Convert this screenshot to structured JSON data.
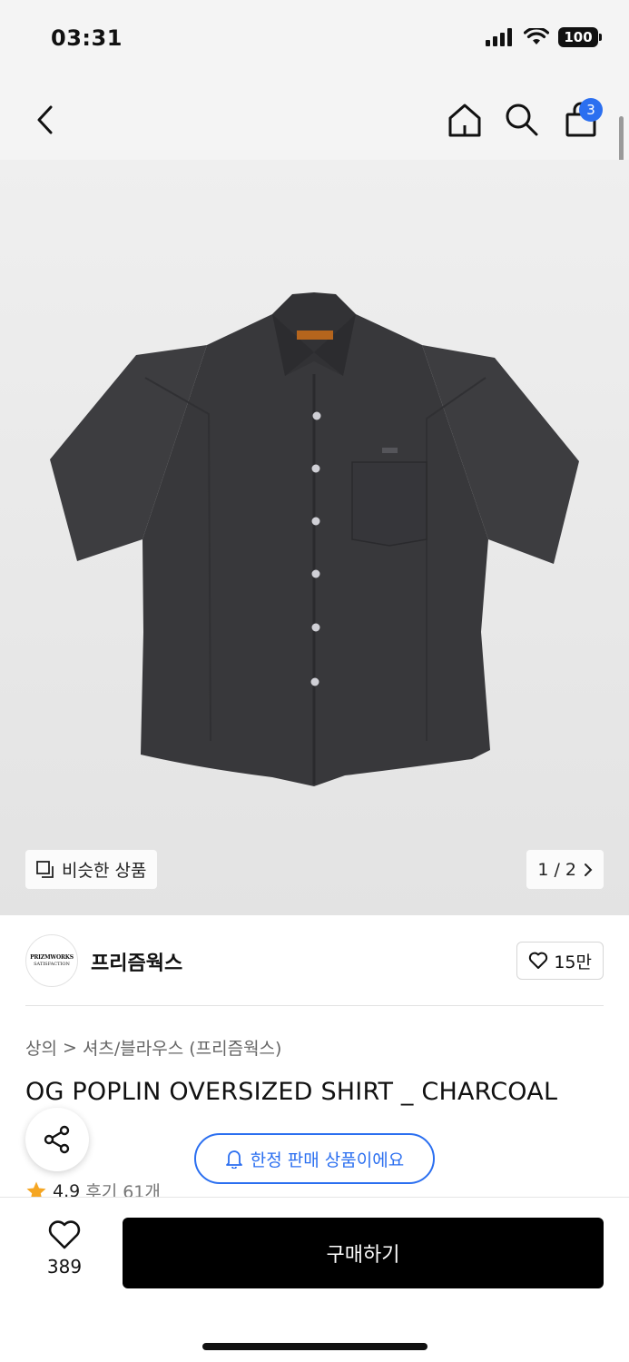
{
  "status_bar": {
    "time": "03:31",
    "battery": "100"
  },
  "nav": {
    "back_icon": "chevron-left-icon",
    "home_icon": "home-icon",
    "search_icon": "search-icon",
    "cart_icon": "shopping-bag-icon",
    "cart_count": "3"
  },
  "gallery": {
    "similar_label": "비슷한 상품",
    "pager_text": "1 / 2",
    "product_image": "charcoal short-sleeve shirt",
    "brand_label_colors": {
      "shirt": "#3a3a3c",
      "label": "#b5651d"
    }
  },
  "brand": {
    "name": "프리즘웍스",
    "logo_line1": "PRIZMWORKS",
    "logo_line2": "SATISFACTION",
    "like_count": "15만"
  },
  "breadcrumb": {
    "level1": "상의",
    "separator": ">",
    "level2": "셔츠/블라우스 (프리즘웍스)"
  },
  "product": {
    "title": "OG POPLIN OVERSIZED SHIRT _ CHARCOAL",
    "rating": "4.9",
    "review_label": "후기 61개"
  },
  "floating": {
    "share_icon": "share-icon",
    "limited_notice": "한정 판매 상품이에요"
  },
  "bottom": {
    "wish_count": "389",
    "buy_label": "구매하기"
  },
  "colors": {
    "accent": "#2b6ff0",
    "buy_bg": "#000000",
    "star": "#f5a623"
  }
}
